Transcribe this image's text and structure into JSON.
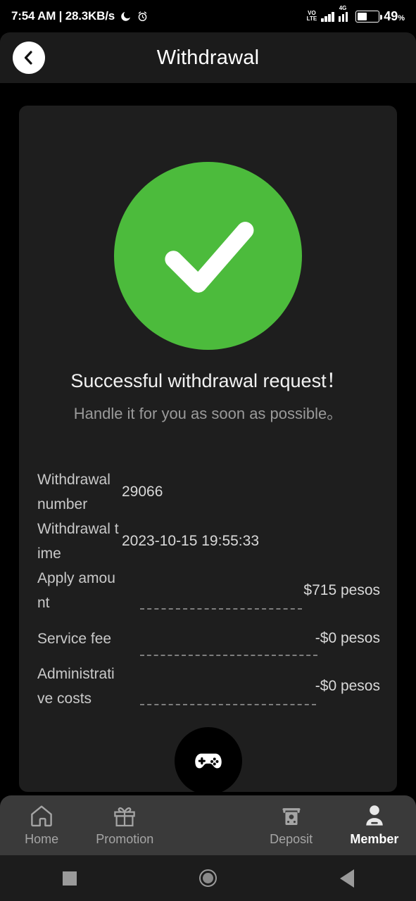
{
  "status_bar": {
    "time_and_speed": "7:54 AM | 28.3KB/s",
    "dnd_icon": "crescent-moon-icon",
    "alarm_icon": "alarm-clock-icon",
    "volte": "VO LTE",
    "network_type": "4G",
    "battery_percent": "49",
    "battery_percent_symbol": "%"
  },
  "header": {
    "title": "Withdrawal",
    "back_icon": "chevron-left-icon"
  },
  "result": {
    "status_icon": "check-circle-icon",
    "headline": "Successful withdrawal request！",
    "subline": "Handle it for you as soon as possible。",
    "accent_color": "#4CBB3C"
  },
  "details": [
    {
      "label": "Withdrawal number",
      "value": "29066",
      "has_dash": false
    },
    {
      "label": "Withdrawal time",
      "value": "2023-10-15 19:55:33",
      "has_dash": false
    },
    {
      "label": "Apply amount",
      "value": "$715 pesos",
      "has_dash": true
    },
    {
      "label": "Service fee",
      "value": "-$0 pesos",
      "has_dash": true
    },
    {
      "label": "Administrative costs",
      "value": "-$0 pesos",
      "has_dash": true
    }
  ],
  "bottom_nav": {
    "items": [
      {
        "label": "Home",
        "icon": "home-icon",
        "active": false
      },
      {
        "label": "Promotion",
        "icon": "gift-icon",
        "active": false
      },
      {
        "label": "Deposit",
        "icon": "atm-cash-icon",
        "active": false
      },
      {
        "label": "Member",
        "icon": "person-icon",
        "active": true
      }
    ],
    "fab_icon": "gamepad-icon"
  },
  "android_nav": {
    "recents_icon": "square-icon",
    "home_icon": "circle-icon",
    "back_icon": "triangle-left-icon"
  }
}
